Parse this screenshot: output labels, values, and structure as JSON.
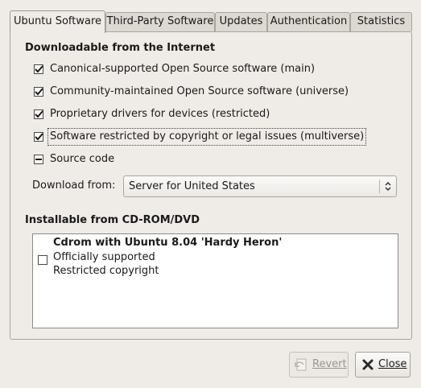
{
  "tabs": [
    {
      "label": "Ubuntu Software",
      "active": true
    },
    {
      "label": "Third-Party Software"
    },
    {
      "label": "Updates"
    },
    {
      "label": "Authentication"
    },
    {
      "label": "Statistics"
    }
  ],
  "internet": {
    "title": "Downloadable from the Internet",
    "options": [
      {
        "label": "Canonical-supported Open Source software (main)",
        "checked": true
      },
      {
        "label": "Community-maintained Open Source software (universe)",
        "checked": true
      },
      {
        "label": "Proprietary drivers for devices (restricted)",
        "checked": true
      },
      {
        "label": "Software restricted by copyright or legal issues (multiverse)",
        "checked": true
      },
      {
        "label": "Source code",
        "checked": "mixed"
      }
    ],
    "download_label": "Download from:",
    "download_value": "Server for United States"
  },
  "cdrom": {
    "title": "Installable from CD-ROM/DVD",
    "item": {
      "name": "Cdrom with Ubuntu 8.04 'Hardy Heron'",
      "line1": "Officially supported",
      "line2": "Restricted copyright",
      "checked": false
    }
  },
  "buttons": {
    "revert": "Revert",
    "close": "Close"
  }
}
